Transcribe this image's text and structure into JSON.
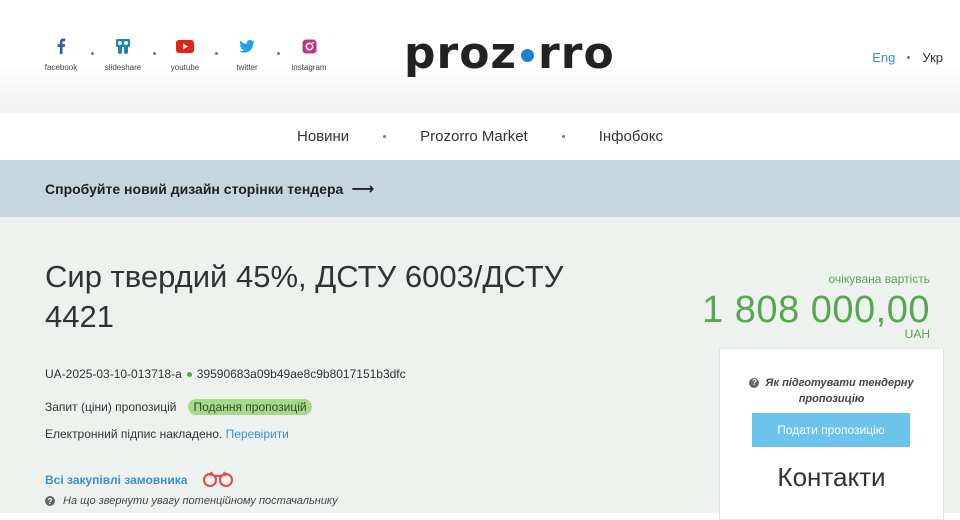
{
  "social": [
    {
      "label": "facebook",
      "icon": "facebook-icon",
      "color": "#3b5998"
    },
    {
      "label": "slideshare",
      "icon": "slideshare-icon",
      "color": "#1f83b7"
    },
    {
      "label": "youtube",
      "icon": "youtube-icon",
      "color": "#e62117"
    },
    {
      "label": "twitter",
      "icon": "twitter-icon",
      "color": "#1da1f2"
    },
    {
      "label": "instagram",
      "icon": "instagram-icon",
      "color": "#c13584"
    }
  ],
  "logo": {
    "left": "proz",
    "right": "rro",
    "dot_color": "#1e7fd6"
  },
  "lang": {
    "eng": "Eng",
    "ukr": "Укр"
  },
  "nav": {
    "items": [
      "Новини",
      "Prozorro Market",
      "Інфобокс"
    ]
  },
  "banner": {
    "text": "Спробуйте новий дизайн сторінки тендера",
    "arrow": "⟶"
  },
  "tender": {
    "title": "Сир твердий 45%, ДСТУ 6003/ДСТУ 4421",
    "id": "UA-2025-03-10-013718-a",
    "hash": "39590683a09b49ae8c9b8017151b3dfc",
    "procedure": "Запит (ціни) пропозицій",
    "status": "Подання пропозицій",
    "signature_text": "Електронний підпис накладено.",
    "verify_link": "Перевірити",
    "all_purchases": "Всі закупівлі замовника",
    "hint": "На що звернути увагу потенційному постачальнику"
  },
  "expected": {
    "label": "очікувана вартість",
    "value": "1 808 000,00",
    "currency": "UAH"
  },
  "card": {
    "hint": "Як підготувати тендерну пропозицію",
    "submit": "Подати пропозицію",
    "contacts": "Контакти"
  },
  "colors": {
    "accent_blue": "#3e8fd1",
    "green": "#5aa552",
    "banner_bg": "#c5d6de",
    "button": "#6cc3ec"
  }
}
